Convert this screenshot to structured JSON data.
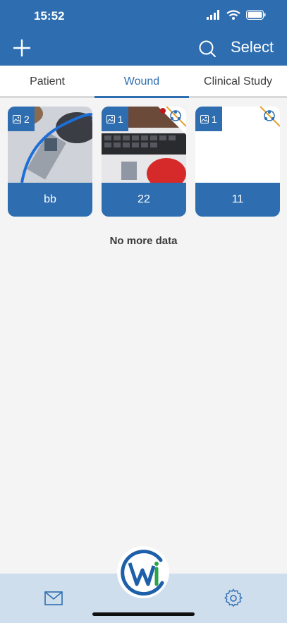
{
  "status_bar": {
    "time": "15:52"
  },
  "toolbar": {
    "add_icon": "plus-icon",
    "search_icon": "search-icon",
    "select_label": "Select"
  },
  "tabs": [
    {
      "label": "Patient"
    },
    {
      "label": "Wound",
      "active": true
    },
    {
      "label": "Clinical Study"
    }
  ],
  "cards": [
    {
      "label": "bb",
      "image_count": "2",
      "photo": "blue cable with QR code"
    },
    {
      "label": "22",
      "image_count": "1",
      "photo": "keyboard, QR label and red mouse"
    },
    {
      "label": "11",
      "image_count": "1",
      "photo": "blank"
    }
  ],
  "list_footer": "No more data",
  "bottom_nav": {
    "left_icon": "mail-icon",
    "center_logo_text": "WAI",
    "right_icon": "gear-icon"
  },
  "colors": {
    "primary": "#2e6eb0",
    "background": "#f4f4f5",
    "bottom_bar": "#cfdeed"
  }
}
